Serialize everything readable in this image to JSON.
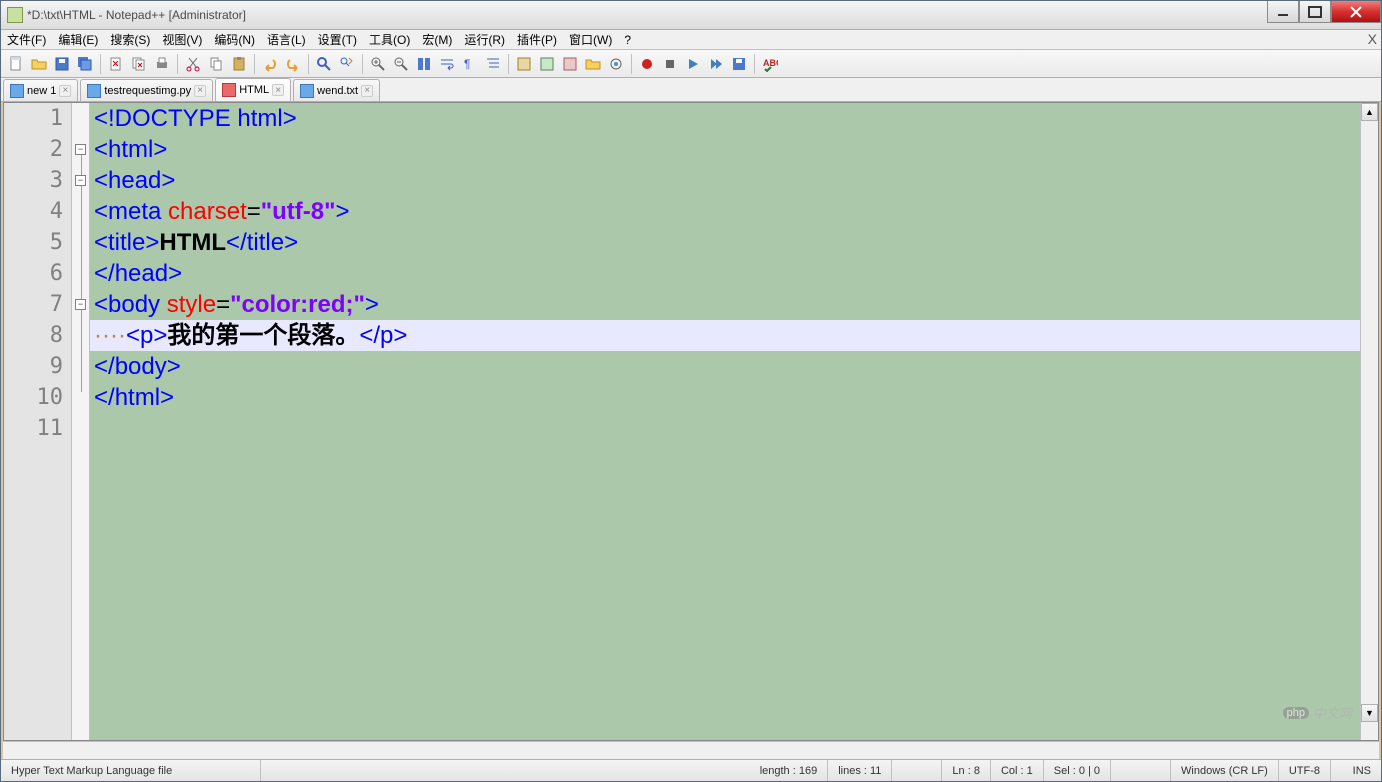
{
  "title": "*D:\\txt\\HTML - Notepad++ [Administrator]",
  "menus": [
    "文件(F)",
    "编辑(E)",
    "搜索(S)",
    "视图(V)",
    "编码(N)",
    "语言(L)",
    "设置(T)",
    "工具(O)",
    "宏(M)",
    "运行(R)",
    "插件(P)",
    "窗口(W)",
    "?"
  ],
  "tabs": [
    {
      "label": "new 1",
      "icon": "blue",
      "active": false
    },
    {
      "label": "testrequestimg.py",
      "icon": "blue",
      "active": false
    },
    {
      "label": "HTML",
      "icon": "red",
      "active": true
    },
    {
      "label": "wend.txt",
      "icon": "blue",
      "active": false
    }
  ],
  "linecount": 11,
  "current_line": 8,
  "code": {
    "l1": {
      "a": "<!DOCTYPE html>"
    },
    "l2": {
      "a": "<",
      "b": "html",
      "c": ">"
    },
    "l3": {
      "a": "<",
      "b": "head",
      "c": ">"
    },
    "l4": {
      "a": "<",
      "b": "meta",
      "sp": " ",
      "attr": "charset",
      "eq": "=",
      "str": "\"utf-8\"",
      "c": ">"
    },
    "l5": {
      "a": "<",
      "b": "title",
      "c": ">",
      "txt": "HTML",
      "d": "</",
      "e": "title",
      "f": ">"
    },
    "l6": {
      "a": "</",
      "b": "head",
      "c": ">"
    },
    "l7": {
      "a": "<",
      "b": "body",
      "sp": " ",
      "attr": "style",
      "eq": "=",
      "str": "\"color:red;\"",
      "c": ">"
    },
    "l8": {
      "dots": "····",
      "a": "<",
      "b": "p",
      "c": ">",
      "txt": "我的第一个段落。",
      "d": "</",
      "e": "p",
      "f": ">"
    },
    "l9": {
      "a": "</",
      "b": "body",
      "c": ">"
    },
    "l10": {
      "a": "</",
      "b": "html",
      "c": ">"
    }
  },
  "status": {
    "filetype": "Hyper Text Markup Language file",
    "length": "length : 169",
    "lines": "lines : 11",
    "ln": "Ln : 8",
    "col": "Col : 1",
    "sel": "Sel : 0 | 0",
    "eol": "Windows (CR LF)",
    "encoding": "UTF-8",
    "mode": "INS"
  },
  "watermark": {
    "logo": "php",
    "text": "中文网"
  }
}
